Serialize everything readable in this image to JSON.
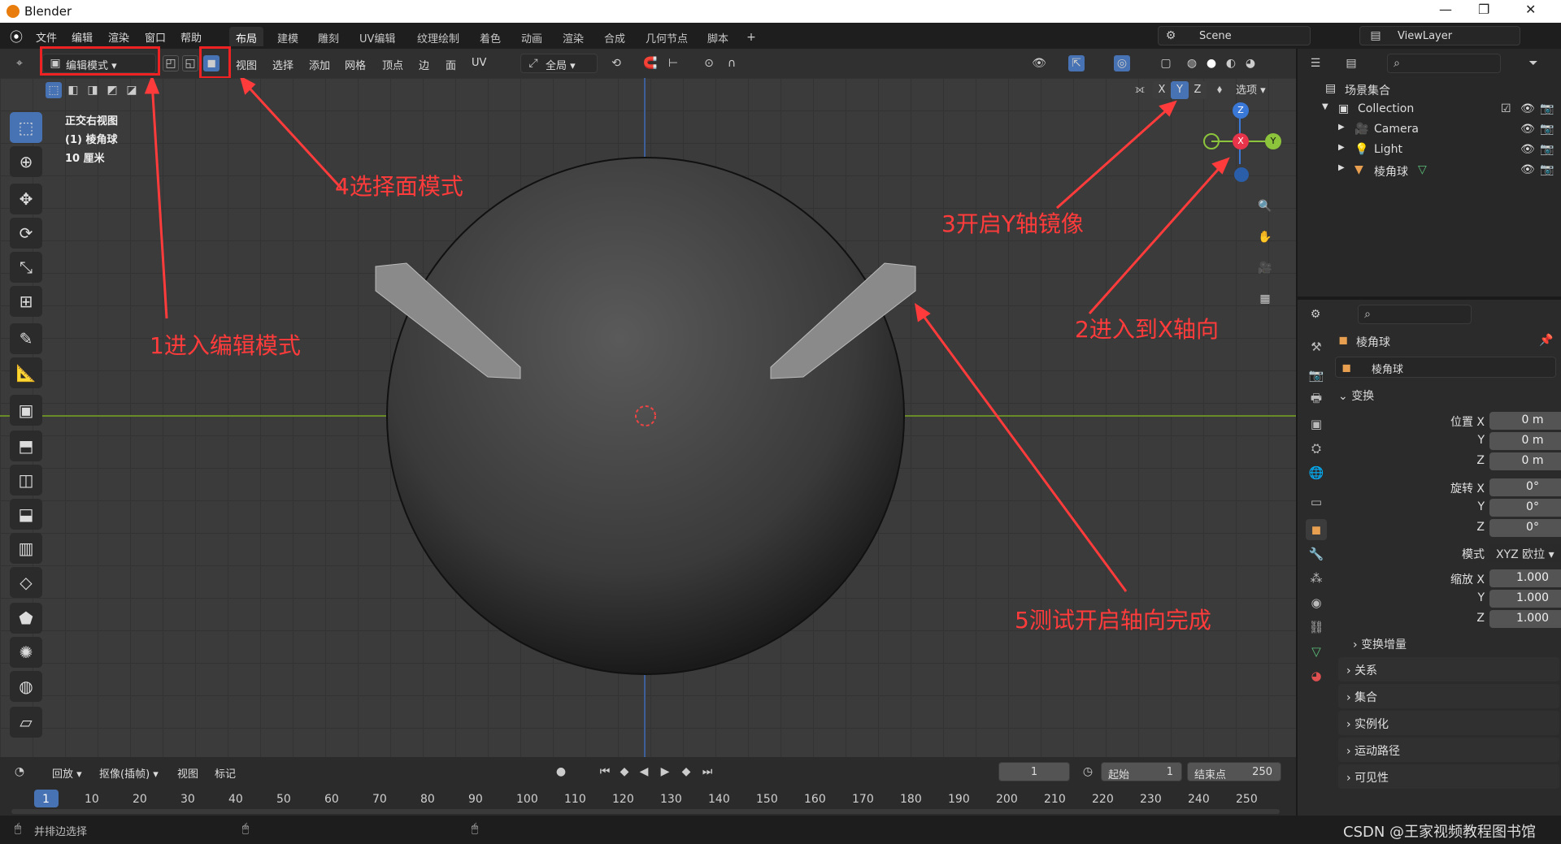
{
  "window": {
    "title": "Blender",
    "controls": [
      "—",
      "❐",
      "✕"
    ]
  },
  "menu": {
    "items": [
      "文件",
      "编辑",
      "渲染",
      "窗口",
      "帮助"
    ]
  },
  "workspaces": [
    "布局",
    "建模",
    "雕刻",
    "UV编辑",
    "纹理绘制",
    "着色",
    "动画",
    "渲染",
    "合成",
    "几何节点",
    "脚本"
  ],
  "scene": {
    "name": "Scene",
    "view_layer": "ViewLayer"
  },
  "header": {
    "mode": "编辑模式",
    "menus": [
      "视图",
      "选择",
      "添加",
      "网格",
      "顶点",
      "边",
      "面",
      "UV"
    ],
    "orientation": "全局",
    "options": "选项",
    "mirror_axes": [
      "X",
      "Y",
      "Z"
    ]
  },
  "viewport": {
    "view_name": "正交右视图",
    "object": "(1) 棱角球",
    "scale": "10 厘米",
    "gizmo": {
      "z": "Z",
      "x": "X",
      "y": "Y"
    }
  },
  "annotations": {
    "a1": "1进入编辑模式",
    "a2": "2进入到X轴向",
    "a3": "3开启Y轴镜像",
    "a4": "4选择面模式",
    "a5": "5测试开启轴向完成"
  },
  "timeline": {
    "playback": "回放",
    "keying": "抠像(插帧)",
    "view": "视图",
    "marker": "标记",
    "current_frame": "1",
    "start_label": "起始",
    "start": "1",
    "end_label": "结束点",
    "end": "250",
    "ticks": [
      "1",
      "10",
      "20",
      "30",
      "40",
      "50",
      "60",
      "70",
      "80",
      "90",
      "100",
      "110",
      "120",
      "130",
      "140",
      "150",
      "160",
      "170",
      "180",
      "190",
      "200",
      "210",
      "220",
      "230",
      "240",
      "250"
    ]
  },
  "status": {
    "left": "并排边选择",
    "watermark": "CSDN @王家视频教程图书馆"
  },
  "outliner": {
    "root": "场景集合",
    "collection": "Collection",
    "items": [
      "Camera",
      "Light",
      "棱角球"
    ]
  },
  "properties": {
    "object_name": "棱角球",
    "data_name": "棱角球",
    "transform_label": "变换",
    "location_label": "位置 X",
    "location": [
      "0 m",
      "0 m",
      "0 m"
    ],
    "rotation_label": "旋转 X",
    "rotation": [
      "0°",
      "0°",
      "0°"
    ],
    "mode_label": "模式",
    "rotation_mode": "XYZ 欧拉",
    "scale_label": "缩放 X",
    "scale": [
      "1.000",
      "1.000",
      "1.000"
    ],
    "axis_y": "Y",
    "axis_z": "Z",
    "delta": "变换增量",
    "sections": [
      "关系",
      "集合",
      "实例化",
      "运动路径",
      "可见性"
    ]
  },
  "colors": {
    "accent": "#4772b3",
    "annotation": "#ff3b3b",
    "x_axis": "#e8344a",
    "y_axis": "#8cc43c",
    "z_axis": "#3a78d8"
  }
}
